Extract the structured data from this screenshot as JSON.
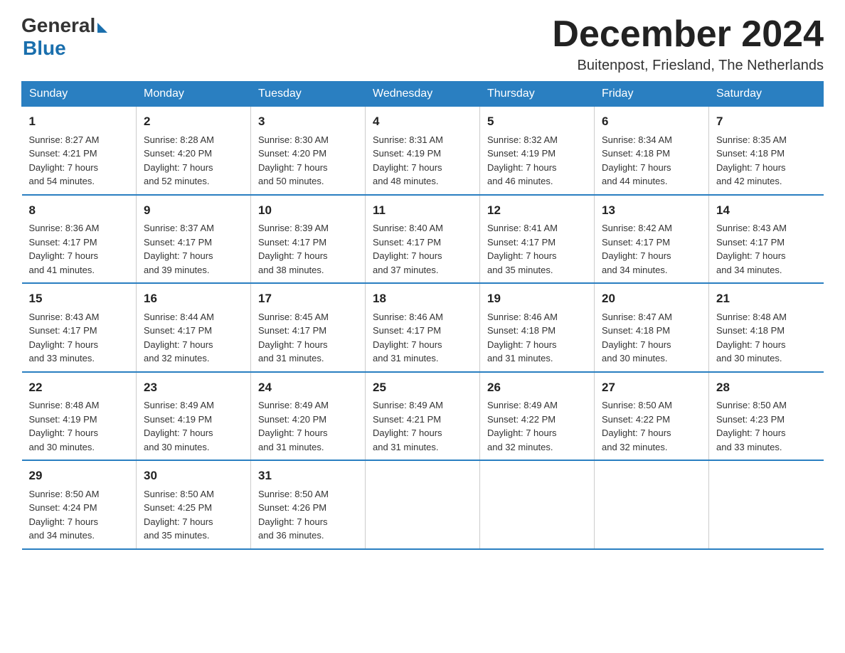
{
  "header": {
    "logo": {
      "general": "General",
      "blue": "Blue"
    },
    "title": "December 2024",
    "subtitle": "Buitenpost, Friesland, The Netherlands"
  },
  "days_of_week": [
    "Sunday",
    "Monday",
    "Tuesday",
    "Wednesday",
    "Thursday",
    "Friday",
    "Saturday"
  ],
  "weeks": [
    [
      {
        "day": "1",
        "sunrise": "8:27 AM",
        "sunset": "4:21 PM",
        "daylight": "7 hours and 54 minutes."
      },
      {
        "day": "2",
        "sunrise": "8:28 AM",
        "sunset": "4:20 PM",
        "daylight": "7 hours and 52 minutes."
      },
      {
        "day": "3",
        "sunrise": "8:30 AM",
        "sunset": "4:20 PM",
        "daylight": "7 hours and 50 minutes."
      },
      {
        "day": "4",
        "sunrise": "8:31 AM",
        "sunset": "4:19 PM",
        "daylight": "7 hours and 48 minutes."
      },
      {
        "day": "5",
        "sunrise": "8:32 AM",
        "sunset": "4:19 PM",
        "daylight": "7 hours and 46 minutes."
      },
      {
        "day": "6",
        "sunrise": "8:34 AM",
        "sunset": "4:18 PM",
        "daylight": "7 hours and 44 minutes."
      },
      {
        "day": "7",
        "sunrise": "8:35 AM",
        "sunset": "4:18 PM",
        "daylight": "7 hours and 42 minutes."
      }
    ],
    [
      {
        "day": "8",
        "sunrise": "8:36 AM",
        "sunset": "4:17 PM",
        "daylight": "7 hours and 41 minutes."
      },
      {
        "day": "9",
        "sunrise": "8:37 AM",
        "sunset": "4:17 PM",
        "daylight": "7 hours and 39 minutes."
      },
      {
        "day": "10",
        "sunrise": "8:39 AM",
        "sunset": "4:17 PM",
        "daylight": "7 hours and 38 minutes."
      },
      {
        "day": "11",
        "sunrise": "8:40 AM",
        "sunset": "4:17 PM",
        "daylight": "7 hours and 37 minutes."
      },
      {
        "day": "12",
        "sunrise": "8:41 AM",
        "sunset": "4:17 PM",
        "daylight": "7 hours and 35 minutes."
      },
      {
        "day": "13",
        "sunrise": "8:42 AM",
        "sunset": "4:17 PM",
        "daylight": "7 hours and 34 minutes."
      },
      {
        "day": "14",
        "sunrise": "8:43 AM",
        "sunset": "4:17 PM",
        "daylight": "7 hours and 34 minutes."
      }
    ],
    [
      {
        "day": "15",
        "sunrise": "8:43 AM",
        "sunset": "4:17 PM",
        "daylight": "7 hours and 33 minutes."
      },
      {
        "day": "16",
        "sunrise": "8:44 AM",
        "sunset": "4:17 PM",
        "daylight": "7 hours and 32 minutes."
      },
      {
        "day": "17",
        "sunrise": "8:45 AM",
        "sunset": "4:17 PM",
        "daylight": "7 hours and 31 minutes."
      },
      {
        "day": "18",
        "sunrise": "8:46 AM",
        "sunset": "4:17 PM",
        "daylight": "7 hours and 31 minutes."
      },
      {
        "day": "19",
        "sunrise": "8:46 AM",
        "sunset": "4:18 PM",
        "daylight": "7 hours and 31 minutes."
      },
      {
        "day": "20",
        "sunrise": "8:47 AM",
        "sunset": "4:18 PM",
        "daylight": "7 hours and 30 minutes."
      },
      {
        "day": "21",
        "sunrise": "8:48 AM",
        "sunset": "4:18 PM",
        "daylight": "7 hours and 30 minutes."
      }
    ],
    [
      {
        "day": "22",
        "sunrise": "8:48 AM",
        "sunset": "4:19 PM",
        "daylight": "7 hours and 30 minutes."
      },
      {
        "day": "23",
        "sunrise": "8:49 AM",
        "sunset": "4:19 PM",
        "daylight": "7 hours and 30 minutes."
      },
      {
        "day": "24",
        "sunrise": "8:49 AM",
        "sunset": "4:20 PM",
        "daylight": "7 hours and 31 minutes."
      },
      {
        "day": "25",
        "sunrise": "8:49 AM",
        "sunset": "4:21 PM",
        "daylight": "7 hours and 31 minutes."
      },
      {
        "day": "26",
        "sunrise": "8:49 AM",
        "sunset": "4:22 PM",
        "daylight": "7 hours and 32 minutes."
      },
      {
        "day": "27",
        "sunrise": "8:50 AM",
        "sunset": "4:22 PM",
        "daylight": "7 hours and 32 minutes."
      },
      {
        "day": "28",
        "sunrise": "8:50 AM",
        "sunset": "4:23 PM",
        "daylight": "7 hours and 33 minutes."
      }
    ],
    [
      {
        "day": "29",
        "sunrise": "8:50 AM",
        "sunset": "4:24 PM",
        "daylight": "7 hours and 34 minutes."
      },
      {
        "day": "30",
        "sunrise": "8:50 AM",
        "sunset": "4:25 PM",
        "daylight": "7 hours and 35 minutes."
      },
      {
        "day": "31",
        "sunrise": "8:50 AM",
        "sunset": "4:26 PM",
        "daylight": "7 hours and 36 minutes."
      },
      null,
      null,
      null,
      null
    ]
  ],
  "labels": {
    "sunrise": "Sunrise:",
    "sunset": "Sunset:",
    "daylight": "Daylight:"
  }
}
